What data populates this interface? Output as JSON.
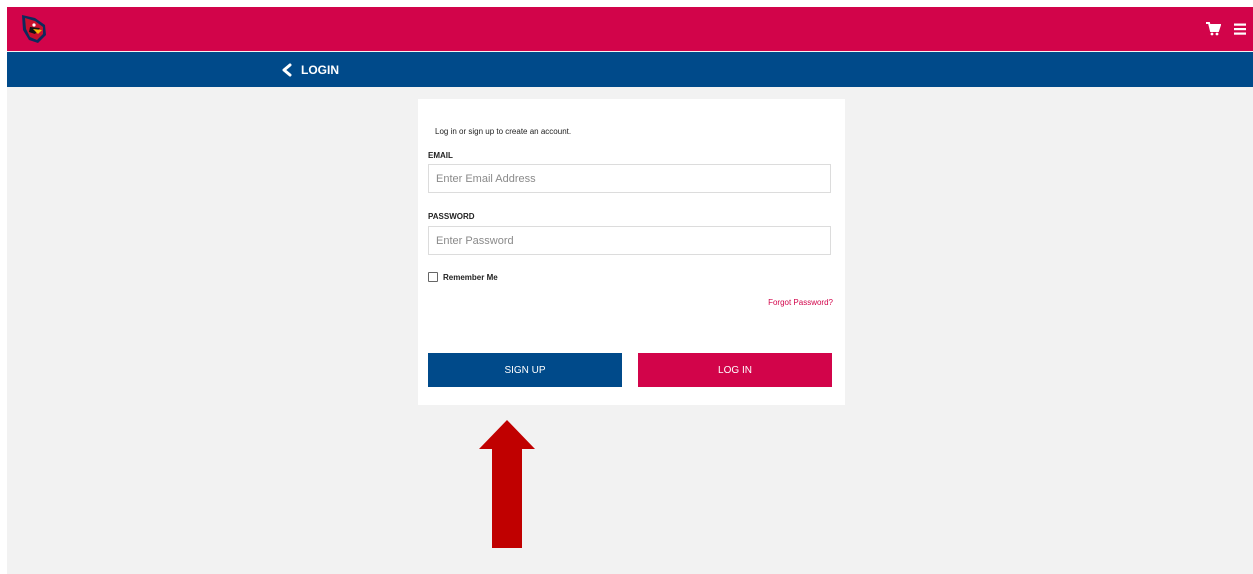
{
  "colors": {
    "primary_red": "#d2044a",
    "primary_blue": "#004a8a",
    "background": "#f2f2f2",
    "arrow_red": "#c00000"
  },
  "header": {
    "logo_icon": "cardinal-logo-icon",
    "cart_icon": "cart-icon",
    "menu_icon": "hamburger-menu-icon"
  },
  "subheader": {
    "back_icon": "chevron-left-icon",
    "title": "LOGIN"
  },
  "form": {
    "intro_text": "Log in or sign up to create an account.",
    "email_label": "EMAIL",
    "email_value": "",
    "email_placeholder": "Enter Email Address",
    "password_label": "PASSWORD",
    "password_value": "",
    "password_placeholder": "Enter Password",
    "remember_label": "Remember Me",
    "remember_checked": false,
    "forgot_label": "Forgot Password?",
    "signup_label": "SIGN UP",
    "login_label": "LOG IN"
  },
  "annotation": {
    "icon": "up-arrow-icon"
  }
}
